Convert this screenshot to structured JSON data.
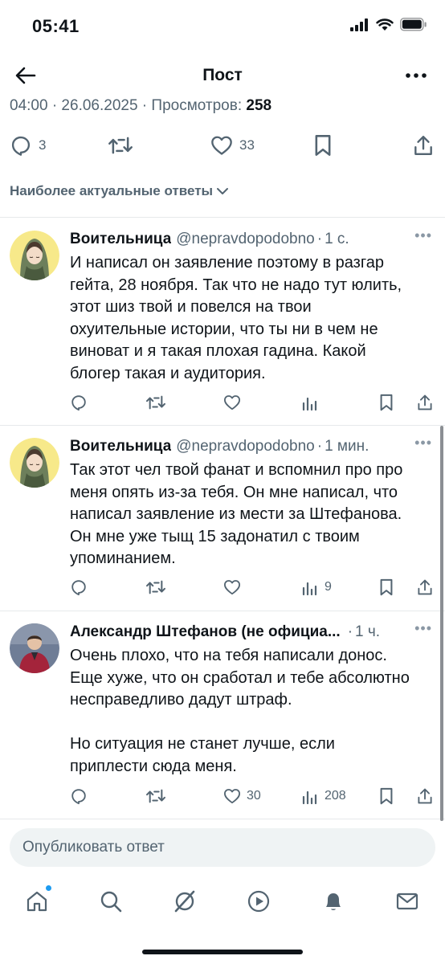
{
  "status_bar": {
    "time": "05:41"
  },
  "header": {
    "title": "Пост"
  },
  "post_meta": {
    "timestamp": "04:00 · 26.06.2025 · Просмотров:",
    "views": "258"
  },
  "post_actions": {
    "replies": "3",
    "retweets": "",
    "likes": "33"
  },
  "sort": {
    "label": "Наиболее актуальные ответы"
  },
  "replies": [
    {
      "name": "Воительница",
      "handle": "@nepravdopodobno",
      "time": "1 с.",
      "text": "И написал он заявление поэтому в разгар\nгейта, 28 ноября. Так что не надо тут юлить,\nэтот шиз твой и повелся на твои\nохуительные истории, что ты ни в чем не\nвиноват и я такая плохая гадина. Какой\nблогер такая и аудитория.",
      "likes": "",
      "views": ""
    },
    {
      "name": "Воительница",
      "handle": "@nepravdopodobno",
      "time": "1 мин.",
      "text": "Так этот чел твой фанат и вспомнил про про\nменя опять из-за тебя. Он мне написал, что\nнаписал заявление из мести за Штефанова.\nОн мне уже тыщ 15 задонатил с твоим\nупоминанием.",
      "likes": "",
      "views": "9"
    },
    {
      "name": "Александр Штефанов (не официа...",
      "handle": "",
      "time": "1 ч.",
      "text": "Очень плохо, что на тебя написали донос.\nЕще хуже, что он сработал и тебе абсолютно\nнесправедливо дадут штраф.\n\nНо ситуация не станет лучше, если\nприплести сюда меня.",
      "likes": "30",
      "views": "208"
    }
  ],
  "compose": {
    "placeholder": "Опубликовать ответ"
  },
  "colors": {
    "text": "#0f1419",
    "muted": "#536471",
    "accent": "#1d9bf0",
    "divider": "#e6e9eb"
  },
  "icons": [
    "back-arrow-icon",
    "more-icon",
    "reply-icon",
    "retweet-icon",
    "like-icon",
    "bookmark-icon",
    "share-icon",
    "views-icon",
    "home-icon",
    "search-icon",
    "grok-icon",
    "video-icon",
    "bell-icon",
    "mail-icon"
  ]
}
